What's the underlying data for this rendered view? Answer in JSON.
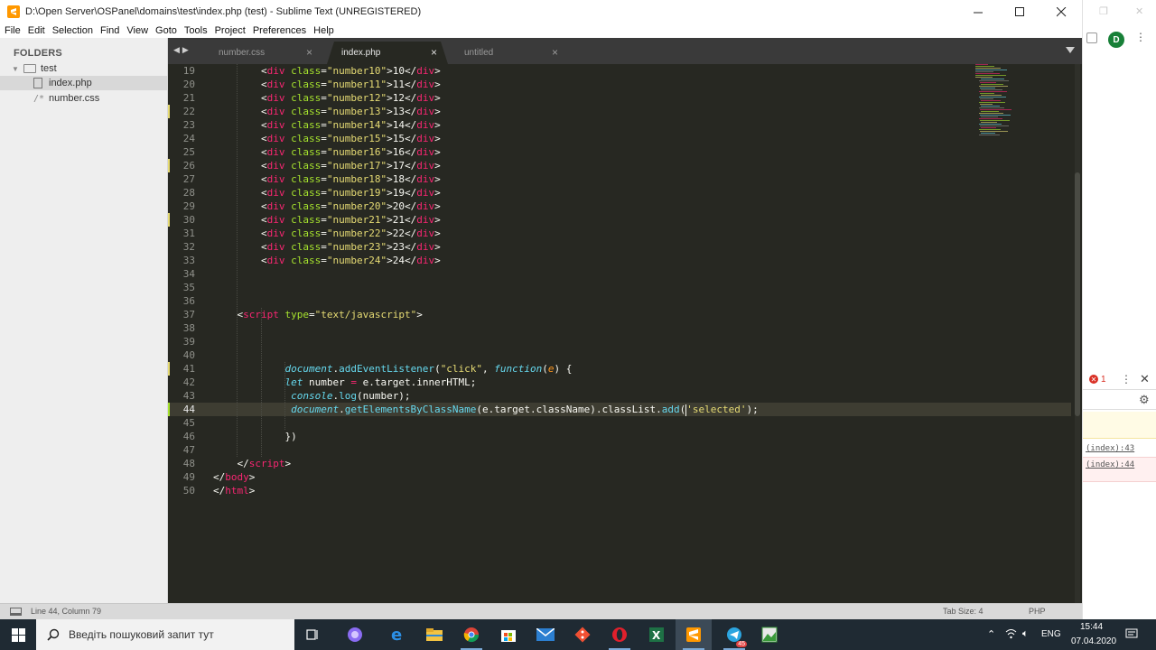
{
  "window": {
    "title": "D:\\Open Server\\OSPanel\\domains\\test\\index.php (test) - Sublime Text (UNREGISTERED)",
    "icon": "sublime-text-icon"
  },
  "menu": [
    "File",
    "Edit",
    "Selection",
    "Find",
    "View",
    "Goto",
    "Tools",
    "Project",
    "Preferences",
    "Help"
  ],
  "sidebar": {
    "header": "FOLDERS",
    "folder": "test",
    "files": [
      {
        "name": "index.php",
        "prefix": ""
      },
      {
        "name": "number.css",
        "prefix": "/*"
      }
    ]
  },
  "tabs": [
    {
      "label": "number.css",
      "active": false
    },
    {
      "label": "index.php",
      "active": true
    },
    {
      "label": "untitled",
      "active": false
    }
  ],
  "tab_close_glyph": "×",
  "editor": {
    "line_numbers": [
      "19",
      "20",
      "21",
      "22",
      "23",
      "24",
      "25",
      "26",
      "27",
      "28",
      "29",
      "30",
      "31",
      "32",
      "33",
      "34",
      "35",
      "36",
      "37",
      "38",
      "39",
      "40",
      "41",
      "42",
      "43",
      "44",
      "45",
      "46",
      "47",
      "48",
      "49",
      "50"
    ],
    "div_rows": [
      {
        "cls": "number10",
        "text": "10"
      },
      {
        "cls": "number11",
        "text": "11"
      },
      {
        "cls": "number12",
        "text": "12"
      },
      {
        "cls": "number13",
        "text": "13"
      },
      {
        "cls": "number14",
        "text": "14"
      },
      {
        "cls": "number15",
        "text": "15"
      },
      {
        "cls": "number16",
        "text": "16"
      },
      {
        "cls": "number17",
        "text": "17"
      },
      {
        "cls": "number18",
        "text": "18"
      },
      {
        "cls": "number19",
        "text": "19"
      },
      {
        "cls": "number20",
        "text": "20"
      },
      {
        "cls": "number21",
        "text": "21"
      },
      {
        "cls": "number22",
        "text": "22"
      },
      {
        "cls": "number23",
        "text": "23"
      },
      {
        "cls": "number24",
        "text": "24"
      }
    ],
    "tokens": {
      "lt": "<",
      "gt": ">",
      "close_lt": "</",
      "div": "div",
      "class": "class",
      "eq": "=",
      "q": "\"",
      "script": "script",
      "type": "type",
      "type_val": "\"text/javascript\"",
      "document": "document",
      "dot": ".",
      "addEventListener": "addEventListener",
      "open_paren": "(",
      "click": "\"click\"",
      "comma_sp": ", ",
      "function": "function",
      "e": "e",
      "fn_tail": ") {",
      "let": "let",
      "number_var": " number ",
      "assign": "=",
      "target_inner": " e.target.innerHTML;",
      "console": "console",
      "log": "log",
      "log_arg": "(number);",
      "getEl": "getElementsByClassName",
      "getEl_arg": "(e.target.className).classList.",
      "add": "add",
      "add_open": "(",
      "selected": "'selected'",
      "add_close": ");",
      "closing_brace": "})",
      "body": "body",
      "html": "html"
    },
    "active_line": "44"
  },
  "status": {
    "position": "Line 44, Column 79",
    "tab_size": "Tab Size: 4",
    "syntax": "PHP"
  },
  "background_window": {
    "avatar_letter": "D",
    "error_count": "1",
    "console_links": [
      "(index):43",
      "(index):44"
    ]
  },
  "taskbar": {
    "search_placeholder": "Введіть пошуковий запит тут",
    "language": "ENG",
    "time": "15:44",
    "date": "07.04.2020",
    "telegram_badge": "45"
  }
}
